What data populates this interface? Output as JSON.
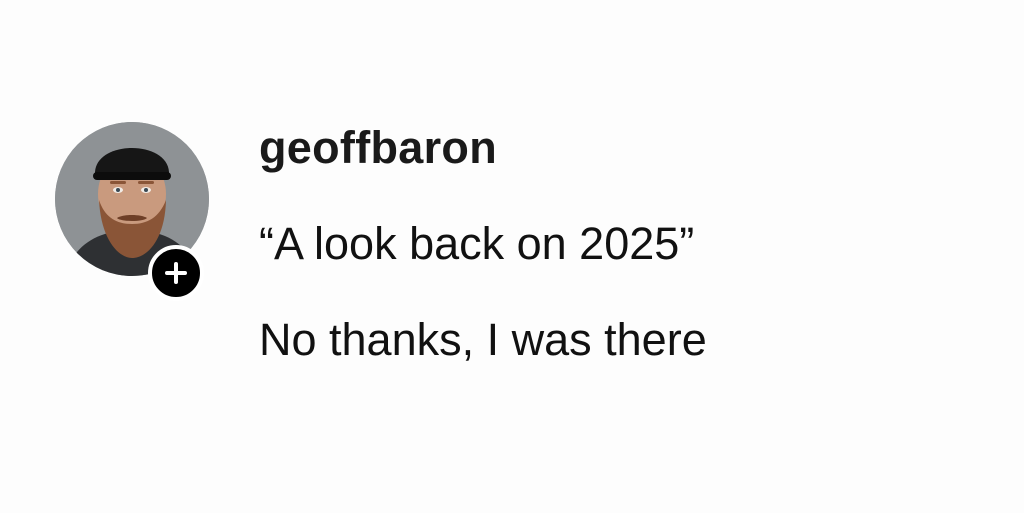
{
  "post": {
    "username": "geoffbaron",
    "lines": [
      "“A look back on 2025”",
      "No thanks, I was there"
    ]
  },
  "icons": {
    "avatar": "profile-photo",
    "follow": "plus-icon"
  },
  "colors": {
    "background": "#fdfdfd",
    "text": "#111111",
    "follow_button": "#000000"
  }
}
